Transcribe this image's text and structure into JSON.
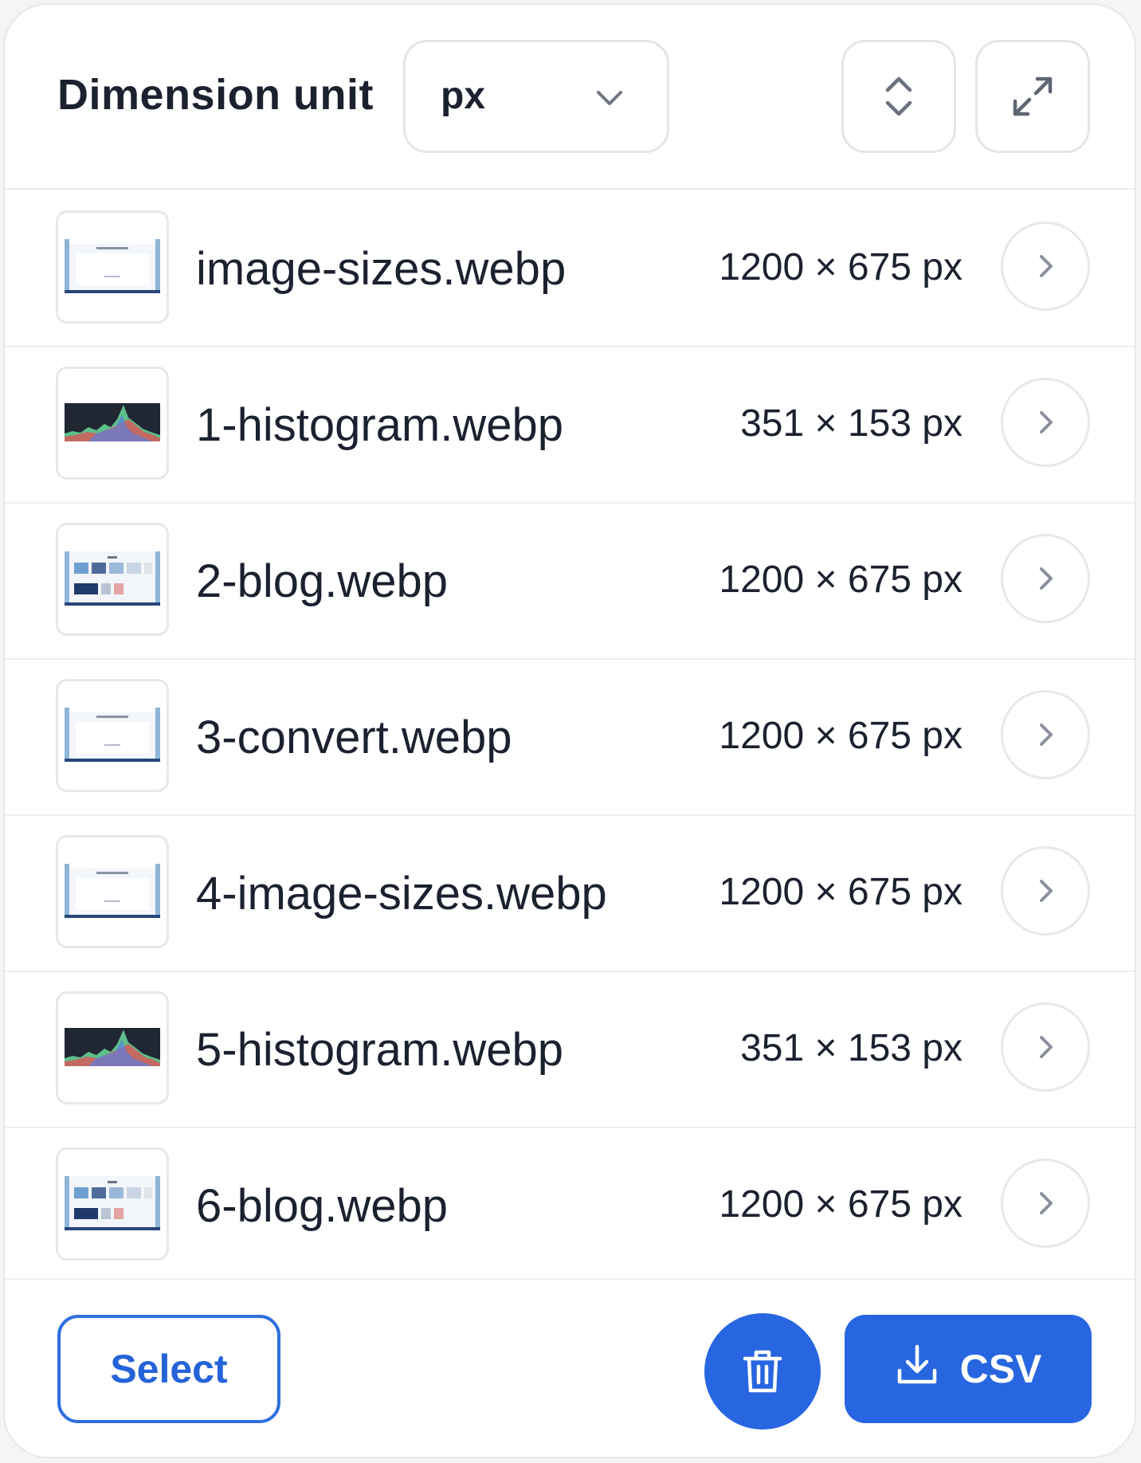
{
  "header": {
    "title": "Dimension unit",
    "unit_selected": "px",
    "unit_icon": "chevron-down-icon",
    "sort_icon": "sort-updown-icon",
    "expand_icon": "expand-icon"
  },
  "files": [
    {
      "name": "image-sizes.webp",
      "dimensions": "1200 × 675 px",
      "thumb": "screenshot"
    },
    {
      "name": "1-histogram.webp",
      "dimensions": "351 × 153 px",
      "thumb": "histogram"
    },
    {
      "name": "2-blog.webp",
      "dimensions": "1200 × 675 px",
      "thumb": "blog"
    },
    {
      "name": "3-convert.webp",
      "dimensions": "1200 × 675 px",
      "thumb": "screenshot"
    },
    {
      "name": "4-image-sizes.webp",
      "dimensions": "1200 × 675 px",
      "thumb": "screenshot"
    },
    {
      "name": "5-histogram.webp",
      "dimensions": "351 × 153 px",
      "thumb": "histogram"
    },
    {
      "name": "6-blog.webp",
      "dimensions": "1200 × 675 px",
      "thumb": "blog"
    }
  ],
  "footer": {
    "select_label": "Select",
    "delete_icon": "trash-icon",
    "csv_label": "CSV",
    "csv_icon": "download-icon"
  },
  "colors": {
    "accent": "#2866e1",
    "text": "#1c2130",
    "border": "#e6e8ec"
  }
}
